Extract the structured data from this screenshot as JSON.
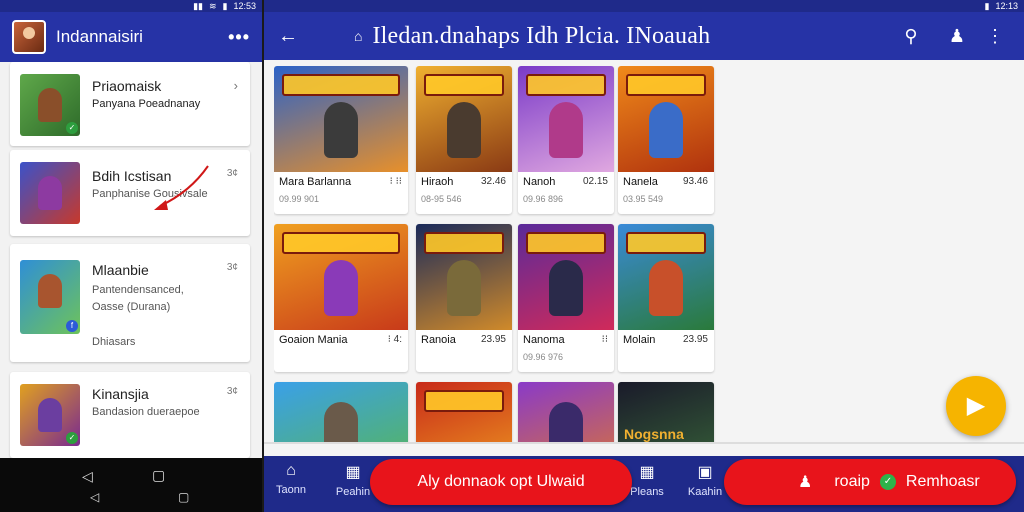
{
  "colors": {
    "appbar": "#2633a6",
    "accent_red": "#e8141b",
    "fab": "#f6b400"
  },
  "status": {
    "time_left": "12:53",
    "time_right": "12:13"
  },
  "left": {
    "title": "Indannaisiri",
    "menu_icon": "more-horizontal-icon",
    "items": [
      {
        "title": "Priaomaisk",
        "subtitle": "Panyana Poeadnanay",
        "meta": "›"
      },
      {
        "title": "Bdih Icstisan",
        "subtitle": "Panphanise Gousivsale",
        "meta": "3¢"
      },
      {
        "title": "Mlaanbie",
        "subtitle": "Pantendensanced, Oasse (Durana)",
        "extra": "Dhiasars",
        "meta": "3¢"
      },
      {
        "title": "Kinansjia",
        "subtitle": "Bandasion dueraepoe",
        "meta": "3¢"
      }
    ]
  },
  "right": {
    "title": "Iledan.dnahaps Idh Plcia. INoauah",
    "icons": [
      "back-icon",
      "search-icon",
      "bell-icon",
      "more-vertical-icon"
    ],
    "tiles": [
      {
        "name": "Mara Barlanna",
        "value": "⁝ ⁝⁝",
        "sub": "09.99 901"
      },
      {
        "name": "Hiraoh",
        "value": "32.46",
        "sub": "08-95 546"
      },
      {
        "name": "Nanoh",
        "value": "02.15",
        "sub": "09.96 896"
      },
      {
        "name": "Nanela",
        "value": "93.46",
        "sub": "03.95 549"
      },
      {
        "name": "Goaion Mania",
        "value": "⁝ 4:",
        "sub": ""
      },
      {
        "name": "Ranoia",
        "value": "23.95",
        "sub": ""
      },
      {
        "name": "Nanoma",
        "value": "⁝⁝",
        "sub": "09.96 976"
      },
      {
        "name": "Molain",
        "value": "23.95",
        "sub": ""
      },
      {
        "name": "",
        "value": "",
        "sub": ""
      },
      {
        "name": "",
        "value": "",
        "sub": ""
      },
      {
        "name": "",
        "value": "",
        "sub": ""
      },
      {
        "name": "Nogsnna",
        "value": "",
        "sub": ""
      }
    ],
    "bottom_nav": [
      {
        "label": "Taonn"
      },
      {
        "label": "Peahin"
      },
      {
        "label": "Pleans"
      },
      {
        "label": "Kaahin"
      }
    ],
    "pill_left": "Aly donnaok opt Ulwaid",
    "pill_right": "roaip",
    "pill_right_2": "Remhoasr"
  }
}
